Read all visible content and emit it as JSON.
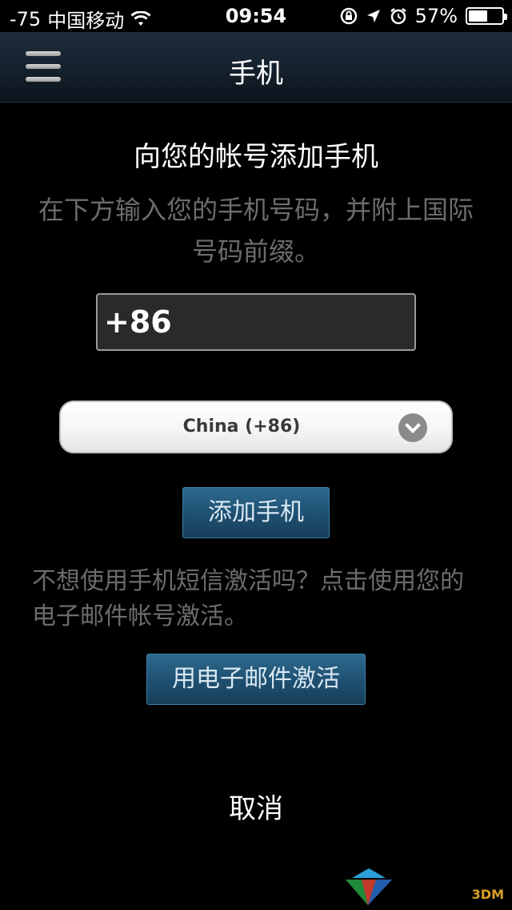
{
  "status_bar": {
    "signal": "-75",
    "carrier": "中国移动",
    "time": "09:54",
    "battery": "57%",
    "battery_fraction": 0.57
  },
  "nav": {
    "title": "手机"
  },
  "content": {
    "headline": "向您的帐号添加手机",
    "instructions": "在下方输入您的手机号码，并附上国际号码前缀。",
    "phone_input_value": "+86",
    "country_selected": "China (+86)",
    "add_phone_label": "添加手机",
    "hint": "不想使用手机短信激活吗？点击使用您的电子邮件帐号激活。",
    "email_activate_label": "用电子邮件激活",
    "cancel_label": "取消"
  },
  "watermark": {
    "text": "3DM"
  },
  "colors": {
    "button_blue": "#1e4f70",
    "muted_text": "#6c6c6c"
  }
}
